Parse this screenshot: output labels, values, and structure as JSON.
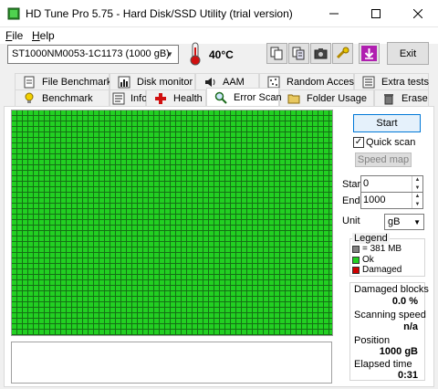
{
  "window": {
    "title": "HD Tune Pro 5.75 - Hard Disk/SSD Utility (trial version)"
  },
  "menu": {
    "file": "File",
    "help": "Help"
  },
  "toolbar": {
    "drive": "ST1000NM0053-1C1173 (1000 gB)",
    "temperature": "40°C",
    "exit": "Exit"
  },
  "tabs_top": [
    "File Benchmark",
    "Disk monitor",
    "AAM",
    "Random Access",
    "Extra tests"
  ],
  "tabs_bottom": [
    "Benchmark",
    "Info",
    "Health",
    "Error Scan",
    "Folder Usage",
    "Erase"
  ],
  "scan": {
    "start": "Start",
    "quick_scan": "Quick scan",
    "speed_map": "Speed map",
    "start_label": "Start",
    "start_value": "0",
    "end_label": "End",
    "end_value": "1000",
    "unit_label": "Unit",
    "unit_value": "gB"
  },
  "legend": {
    "title": "Legend",
    "block": "= 381 MB",
    "ok": "Ok",
    "damaged": "Damaged"
  },
  "stats": {
    "damaged_label": "Damaged blocks",
    "damaged_value": "0.0 %",
    "speed_label": "Scanning speed",
    "speed_value": "n/a",
    "position_label": "Position",
    "position_value": "1000 gB",
    "elapsed_label": "Elapsed time",
    "elapsed_value": "0:31"
  },
  "colors": {
    "ok": "#22d022",
    "damaged": "#d00000",
    "block": "#808080",
    "accent": "#0078d7"
  }
}
